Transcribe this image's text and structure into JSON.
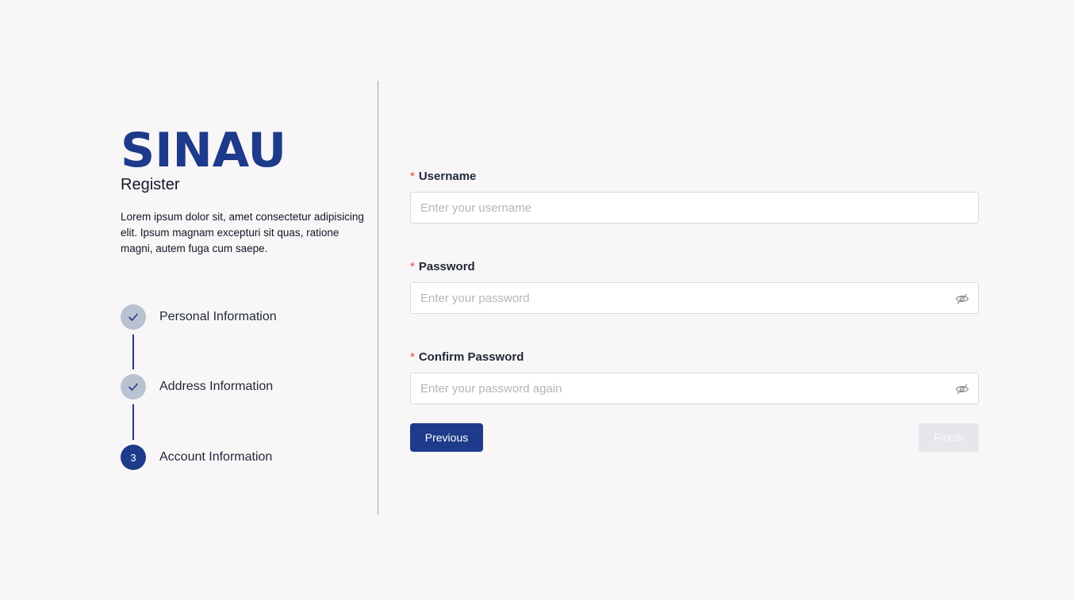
{
  "brand": {
    "name": "SINAU",
    "color": "#1e3a8a"
  },
  "page": {
    "subtitle": "Register",
    "description": "Lorem ipsum dolor sit, amet consectetur adipisicing elit. Ipsum magnam excepturi sit quas, ratione magni, autem fuga cum saepe."
  },
  "steps": [
    {
      "label": "Personal Information",
      "status": "done",
      "icon": "check-icon"
    },
    {
      "label": "Address Information",
      "status": "done",
      "icon": "check-icon"
    },
    {
      "label": "Account Information",
      "status": "current",
      "number": "3"
    }
  ],
  "form": {
    "required_mark": "*",
    "username": {
      "label": "Username",
      "placeholder": "Enter your username",
      "value": ""
    },
    "password": {
      "label": "Password",
      "placeholder": "Enter your password",
      "value": "",
      "icon": "eye-off-icon"
    },
    "confirm_password": {
      "label": "Confirm Password",
      "placeholder": "Enter your password again",
      "value": "",
      "icon": "eye-off-icon"
    }
  },
  "buttons": {
    "previous": "Previous",
    "finish": "Finish",
    "finish_disabled": true
  },
  "colors": {
    "primary": "#1e3a8a",
    "required": "#ef4444",
    "step_done": "#b9c2d1",
    "background": "#f8f6f7"
  }
}
